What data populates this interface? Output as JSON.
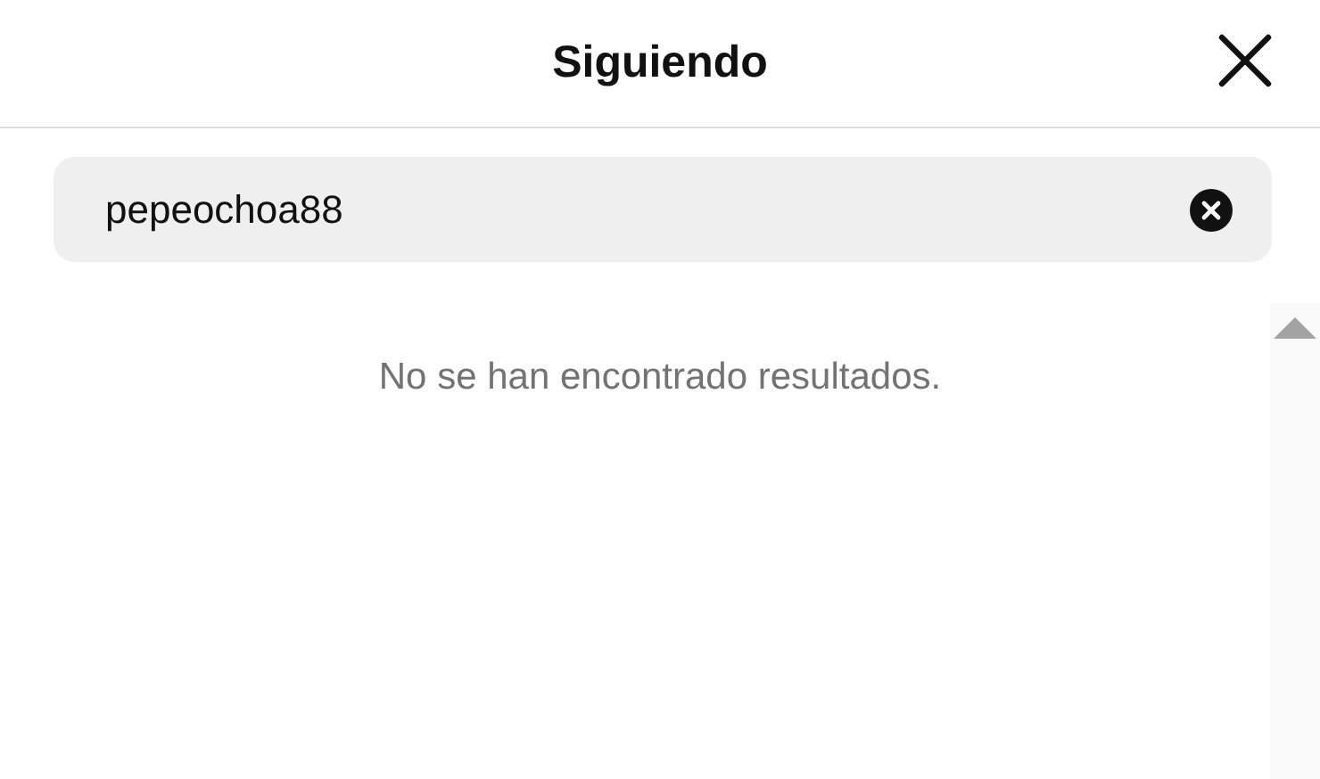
{
  "dialog": {
    "title": "Siguiendo"
  },
  "search": {
    "value": "pepeochoa88"
  },
  "message": "No se han encontrado resultados."
}
